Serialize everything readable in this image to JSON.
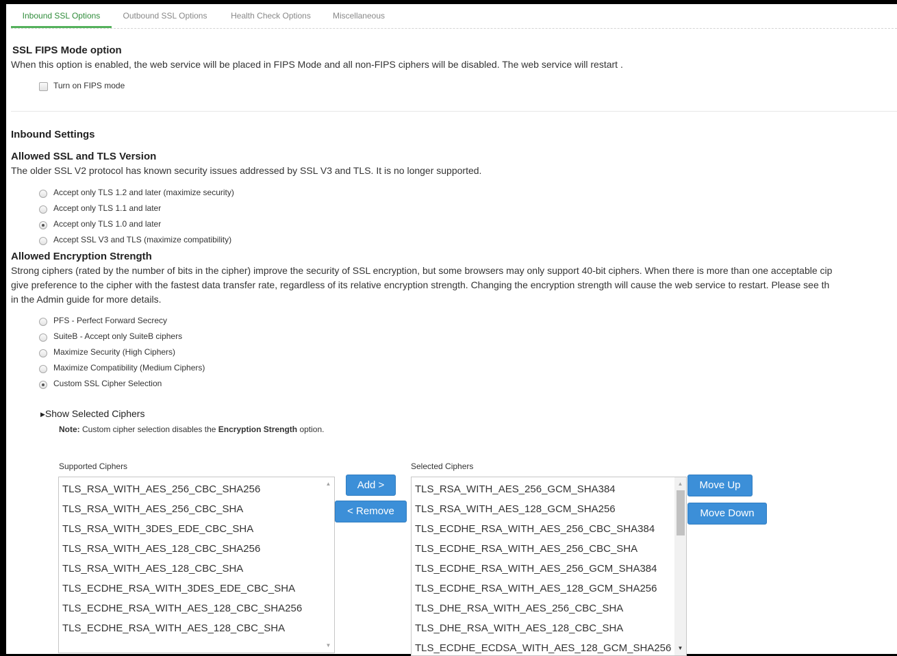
{
  "tabs": [
    {
      "label": "Inbound SSL Options",
      "active": true
    },
    {
      "label": "Outbound SSL Options",
      "active": false
    },
    {
      "label": "Health Check Options",
      "active": false
    },
    {
      "label": "Miscellaneous",
      "active": false
    }
  ],
  "fips": {
    "title": "SSL FIPS Mode option",
    "description": "When this option is enabled, the web service will be placed in FIPS Mode and all non-FIPS ciphers will be disabled. The web service will restart .",
    "checkbox_label": "Turn on FIPS mode",
    "checked": false
  },
  "inbound": {
    "title": "Inbound Settings"
  },
  "tls_version": {
    "title": "Allowed SSL and TLS Version",
    "description": "The older SSL V2 protocol has known security issues addressed by SSL V3 and TLS. It is no longer supported.",
    "options": [
      {
        "label": "Accept only TLS 1.2 and later (maximize security)",
        "selected": false
      },
      {
        "label": "Accept only TLS 1.1 and later",
        "selected": false
      },
      {
        "label": "Accept only TLS 1.0 and later",
        "selected": true
      },
      {
        "label": "Accept SSL V3 and TLS (maximize compatibility)",
        "selected": false
      }
    ]
  },
  "encryption": {
    "title": "Allowed Encryption Strength",
    "description_lines": [
      "Strong ciphers (rated by the number of bits in the cipher) improve the security of SSL encryption, but some browsers may only support 40-bit ciphers. When there is more than one acceptable cip",
      "give preference to the cipher with the fastest data transfer rate, regardless of its relative encryption strength. Changing the encryption strength will cause the web service to restart. Please see th",
      "in the Admin guide for more details."
    ],
    "options": [
      {
        "label": "PFS - Perfect Forward Secrecy",
        "selected": false
      },
      {
        "label": "SuiteB - Accept only SuiteB ciphers",
        "selected": false
      },
      {
        "label": "Maximize Security (High Ciphers)",
        "selected": false
      },
      {
        "label": "Maximize Compatibility (Medium Ciphers)",
        "selected": false
      },
      {
        "label": "Custom SSL Cipher Selection",
        "selected": true
      }
    ]
  },
  "ciphers": {
    "toggle_label": "Show Selected Ciphers",
    "note_prefix": "Note:",
    "note_text": " Custom cipher selection disables the ",
    "note_bold": "Encryption Strength",
    "note_suffix": " option.",
    "supported_label": "Supported Ciphers",
    "selected_label": "Selected Ciphers",
    "supported": [
      "TLS_RSA_WITH_AES_256_CBC_SHA256",
      "TLS_RSA_WITH_AES_256_CBC_SHA",
      "TLS_RSA_WITH_3DES_EDE_CBC_SHA",
      "TLS_RSA_WITH_AES_128_CBC_SHA256",
      "TLS_RSA_WITH_AES_128_CBC_SHA",
      "TLS_ECDHE_RSA_WITH_3DES_EDE_CBC_SHA",
      "TLS_ECDHE_RSA_WITH_AES_128_CBC_SHA256",
      "TLS_ECDHE_RSA_WITH_AES_128_CBC_SHA"
    ],
    "selected": [
      "TLS_RSA_WITH_AES_256_GCM_SHA384",
      "TLS_RSA_WITH_AES_128_GCM_SHA256",
      "TLS_ECDHE_RSA_WITH_AES_256_CBC_SHA384",
      "TLS_ECDHE_RSA_WITH_AES_256_CBC_SHA",
      "TLS_ECDHE_RSA_WITH_AES_256_GCM_SHA384",
      "TLS_ECDHE_RSA_WITH_AES_128_GCM_SHA256",
      "TLS_DHE_RSA_WITH_AES_256_CBC_SHA",
      "TLS_DHE_RSA_WITH_AES_128_CBC_SHA",
      "TLS_ECDHE_ECDSA_WITH_AES_128_GCM_SHA256"
    ],
    "buttons": {
      "add": "Add >",
      "remove": "< Remove",
      "move_up": "Move Up",
      "move_down": "Move Down"
    }
  },
  "colors": {
    "active_tab": "#2f8c3a",
    "button": "#3c8fd8"
  }
}
